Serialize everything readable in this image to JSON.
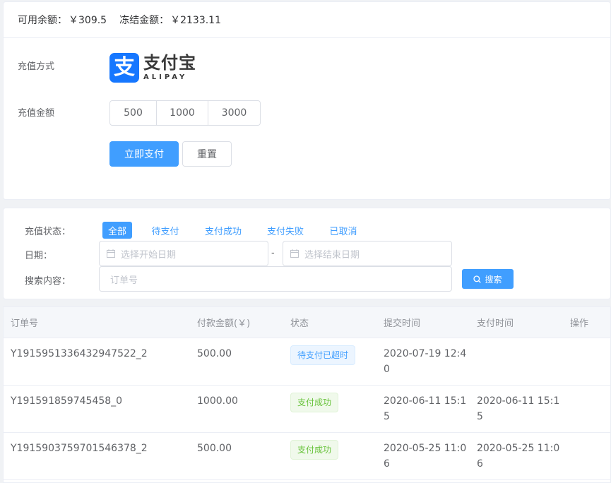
{
  "balance": {
    "available_label": "可用余额：",
    "available_value": "￥309.5",
    "frozen_label": "冻结金额：",
    "frozen_value": "￥2133.11"
  },
  "recharge": {
    "method_label": "充值方式",
    "alipay_cn": "支付宝",
    "alipay_en": "ALIPAY",
    "amount_label": "充值金额",
    "amounts": [
      "500",
      "1000",
      "3000"
    ],
    "pay_button": "立即支付",
    "reset_button": "重置"
  },
  "filter": {
    "status_label": "充值状态：",
    "status_tabs": [
      "全部",
      "待支付",
      "支付成功",
      "支付失败",
      "已取消"
    ],
    "active_tab": "全部",
    "date_label": "日期：",
    "start_placeholder": "选择开始日期",
    "date_separator": "-",
    "end_placeholder": "选择结束日期",
    "search_label": "搜索内容：",
    "search_placeholder": "订单号",
    "search_button": "搜索"
  },
  "table": {
    "headers": [
      "订单号",
      "付款金额(￥)",
      "状态",
      "提交时间",
      "支付时间",
      "操作"
    ],
    "rows": [
      {
        "order": "Y1915951336432947522_2",
        "amount": "500.00",
        "status": "待支付已超时",
        "status_type": "info",
        "submit_time": "2020-07-19 12:40",
        "pay_time": ""
      },
      {
        "order": "Y191591859745458_0",
        "amount": "1000.00",
        "status": "支付成功",
        "status_type": "success",
        "submit_time": "2020-06-11 15:15",
        "pay_time": "2020-06-11 15:15"
      },
      {
        "order": "Y1915903759701546378_2",
        "amount": "500.00",
        "status": "支付成功",
        "status_type": "success",
        "submit_time": "2020-05-25 11:06",
        "pay_time": "2020-05-25 11:06"
      }
    ]
  },
  "colors": {
    "primary": "#409eff",
    "success": "#67c23a",
    "alipay": "#1677ff"
  }
}
